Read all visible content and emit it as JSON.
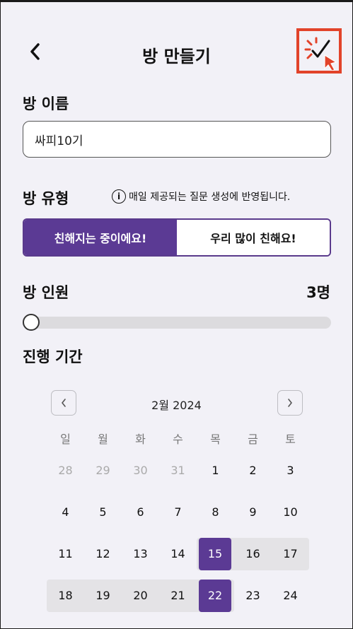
{
  "header": {
    "title": "방 만들기",
    "back_icon": "chevron-left-icon",
    "confirm_icon": "check-icon"
  },
  "room_name": {
    "label": "방 이름",
    "value": "싸피10기"
  },
  "room_type": {
    "label": "방 유형",
    "info_text": "매일 제공되는 질문 생성에 반영됩니다.",
    "options": [
      "친해지는 중이에요!",
      "우리 많이 친해요!"
    ],
    "selected_index": 0
  },
  "room_members": {
    "label": "방 인원",
    "count": "3명",
    "slider_fraction": 0.0
  },
  "period": {
    "label": "진행 기간",
    "month": "2월 2024",
    "weekdays": [
      "일",
      "월",
      "화",
      "수",
      "목",
      "금",
      "토"
    ],
    "weeks": [
      [
        "28",
        "29",
        "30",
        "31",
        "1",
        "2",
        "3"
      ],
      [
        "4",
        "5",
        "6",
        "7",
        "8",
        "9",
        "10"
      ],
      [
        "11",
        "12",
        "13",
        "14",
        "15",
        "16",
        "17"
      ],
      [
        "18",
        "19",
        "20",
        "21",
        "22",
        "23",
        "24"
      ]
    ],
    "selected_start": "15",
    "selected_end": "22"
  },
  "colors": {
    "accent": "#5b3a94",
    "range": "#e4e3e6",
    "highlight": "#e2432a"
  }
}
